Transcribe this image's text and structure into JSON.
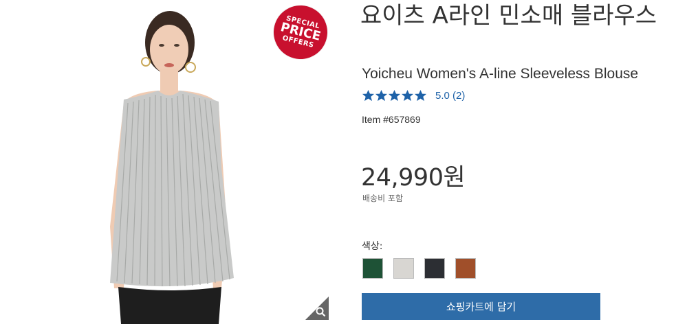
{
  "badge": {
    "line1": "SPECIAL",
    "line2": "PRICE",
    "line3": "OFFERS"
  },
  "product": {
    "title_ko": "요이츠 A라인 민소매 블라우스",
    "title_en": "Yoicheu Women's A-line Sleeveless Blouse",
    "rating_value": 5.0,
    "rating_text": "5.0 (2)",
    "item_number": "Item #657869",
    "price": "24,990원",
    "shipping": "배송비 포함",
    "color_label": "색상:",
    "colors": [
      "#1e5236",
      "#d8d6d2",
      "#2c2e33",
      "#a04f2a"
    ],
    "add_to_cart": "쇼핑카트에 담기"
  },
  "icons": {
    "zoom": "magnifier-icon",
    "star": "star-icon"
  },
  "accent_color": "#2e6ca8"
}
